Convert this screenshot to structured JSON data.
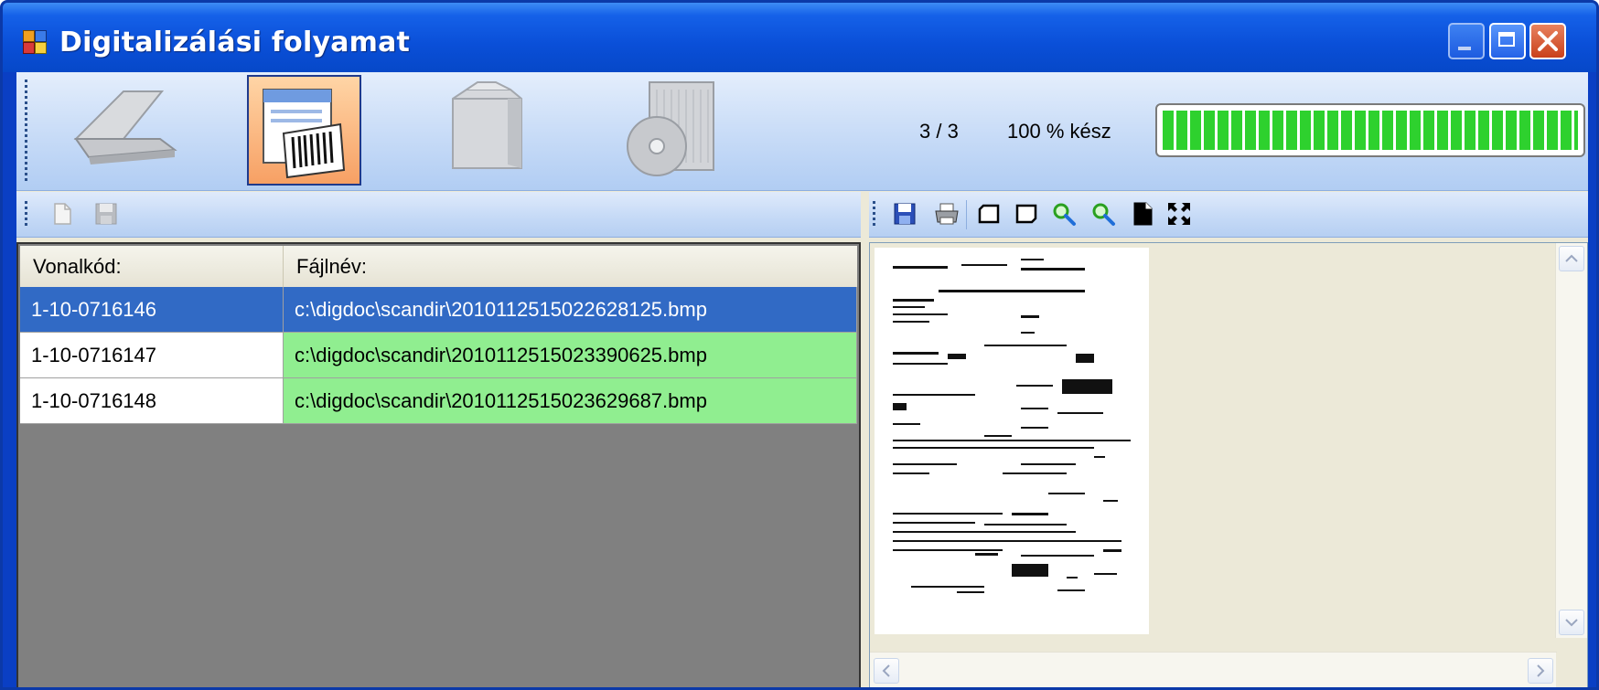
{
  "window": {
    "title": "Digitalizálási folyamat",
    "accent_color": "#0a4fd8",
    "controls": [
      "minimize-icon",
      "maximize-icon",
      "close-icon"
    ]
  },
  "main_toolbar": {
    "steps": [
      {
        "name": "scanner-icon",
        "active": false
      },
      {
        "name": "barcode-document-icon",
        "active": true
      },
      {
        "name": "package-icon",
        "active": false
      },
      {
        "name": "archive-disc-icon",
        "active": false
      }
    ],
    "count_text": "3 / 3",
    "percent_text": "100 % kész",
    "progress_fraction": 1.0,
    "progress_color": "#2ed12e"
  },
  "left_toolbar": {
    "icons": [
      "new-document-icon",
      "save-icon"
    ]
  },
  "right_toolbar": {
    "icons": [
      "save-icon",
      "print-icon",
      "rotate-left-icon",
      "rotate-right-icon",
      "zoom-in-icon",
      "zoom-out-icon",
      "fit-page-icon",
      "fullscreen-icon"
    ]
  },
  "grid": {
    "columns": [
      "Vonalkód:",
      "Fájlnév:"
    ],
    "rows": [
      {
        "barcode": "1-10-0716146",
        "file": "c:\\digdoc\\scandir\\20101125150226281​25.bmp",
        "selected": true
      },
      {
        "barcode": "1-10-0716147",
        "file": "c:\\digdoc\\scandir\\201011251502339062​5.bmp",
        "selected": false
      },
      {
        "barcode": "1-10-0716148",
        "file": "c:\\digdoc\\scandir\\201011251502362968​7.bmp",
        "selected": false
      }
    ],
    "selected_color": "#316ac5",
    "ok_color": "#90ee90"
  }
}
